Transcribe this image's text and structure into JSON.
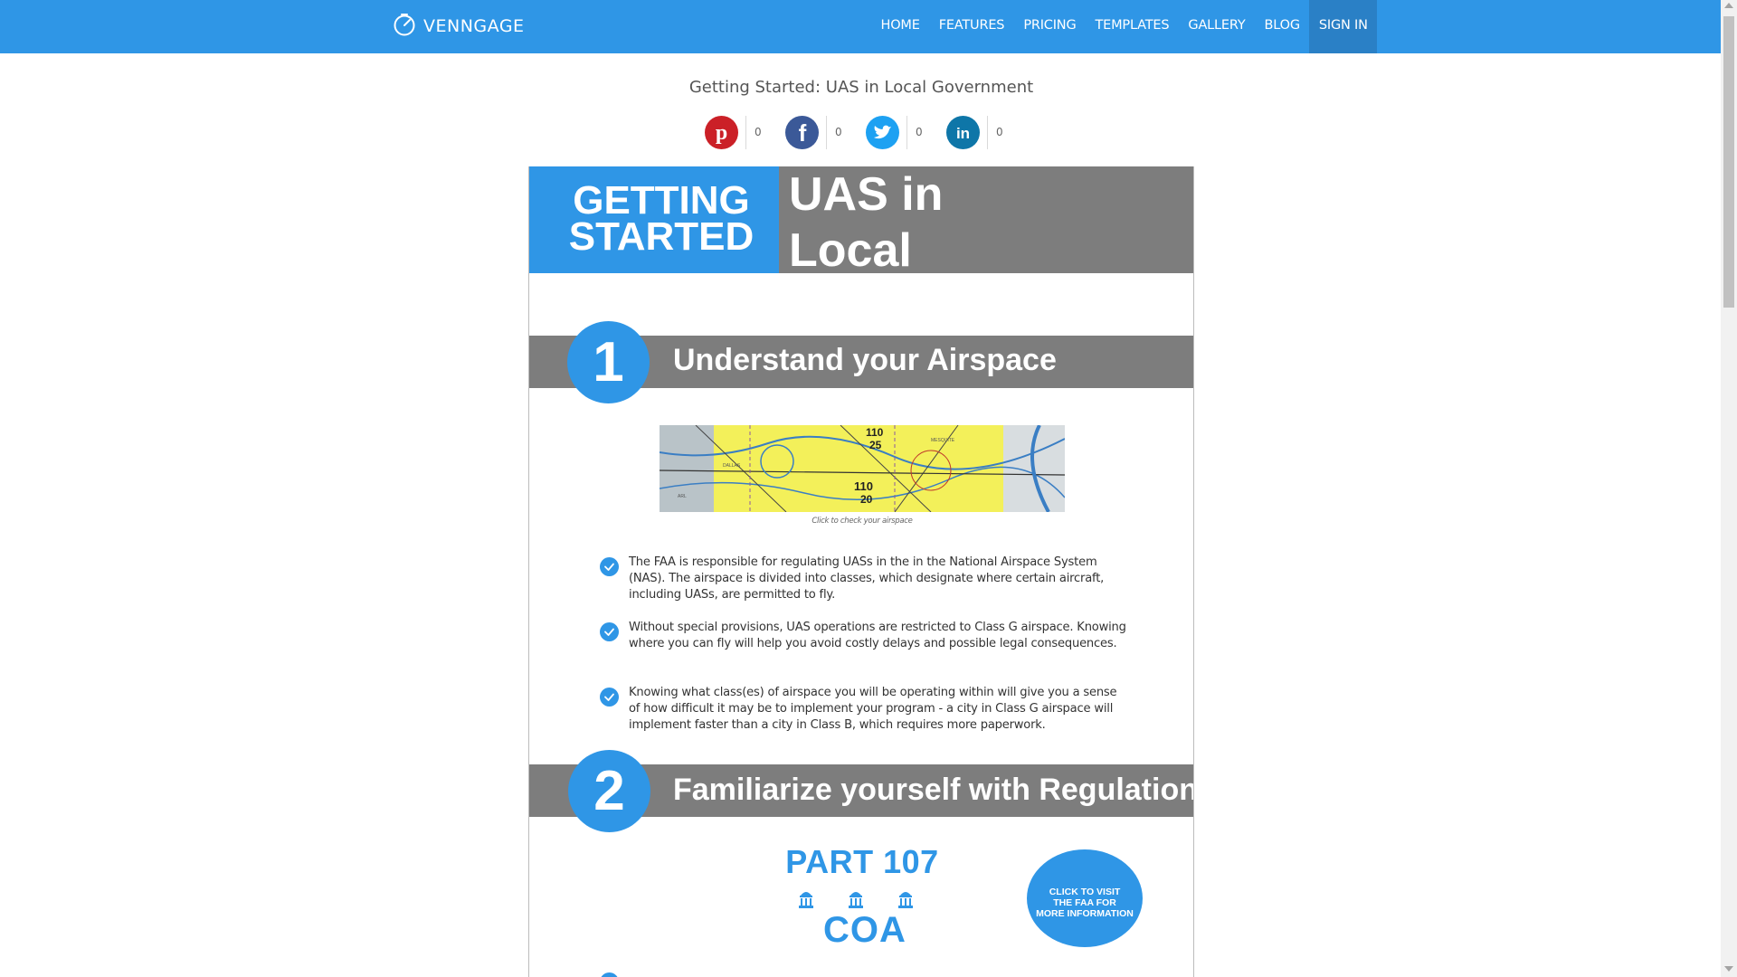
{
  "nav": {
    "logo_text": "VENNGAGE",
    "links": [
      "HOME",
      "FEATURES",
      "PRICING",
      "TEMPLATES",
      "GALLERY",
      "BLOG",
      "SIGN IN"
    ]
  },
  "page_title": "Getting Started: UAS in Local Government",
  "share": [
    {
      "network": "pinterest",
      "icon": "pinterest-icon",
      "color": "#cb2027",
      "count": "0"
    },
    {
      "network": "facebook",
      "icon": "facebook-icon",
      "color": "#3b5998",
      "count": "0"
    },
    {
      "network": "twitter",
      "icon": "twitter-icon",
      "color": "#1da1f2",
      "count": "0"
    },
    {
      "network": "linkedin",
      "icon": "linkedin-icon",
      "color": "#0e76a8",
      "count": "0"
    }
  ],
  "infographic": {
    "header_left": [
      "GETTING",
      "STARTED"
    ],
    "header_right": [
      "UAS in",
      "Local Government"
    ],
    "sections": [
      {
        "number": "1",
        "title": "Understand your Airspace"
      },
      {
        "number": "2",
        "title": "Familiarize yourself with Regulations"
      }
    ],
    "map_caption": "Click to check your airspace",
    "section1_bullets": [
      "The FAA is responsible for regulating UASs in the in the National Airspace System (NAS). The airspace is divided into classes, which designate where certain aircraft, including UASs, are permitted to fly.",
      "Without special provisions, UAS operations are restricted to Class G airspace. Knowing where you can fly will help you avoid costly delays and possible legal consequences.",
      "Knowing what class(es) of airspace you will be operating within will give you a sense of how difficult it may be to implement your program - a city in Class G airspace will implement faster than a city in Class B, which requires more paperwork."
    ],
    "part107": "PART 107",
    "coa": "COA",
    "faa_button": [
      "CLICK TO VISIT",
      "THE FAA FOR",
      "MORE INFORMATION"
    ]
  },
  "colors": {
    "brand_blue": "#2f96e6",
    "band_gray": "#7d7d7d",
    "nav_active": "#2a80c6"
  }
}
